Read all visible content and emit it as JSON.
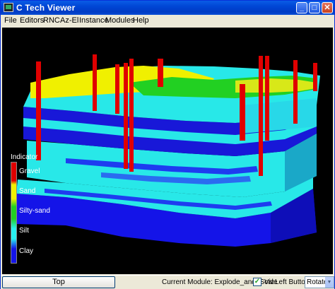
{
  "window": {
    "title": "C Tech Viewer"
  },
  "menu": {
    "items": [
      "File",
      "Editors",
      "RNC",
      "Az-El",
      "Instance",
      "Modules",
      "Help"
    ]
  },
  "legend": {
    "title": "Indicator",
    "labels": [
      "Gravel",
      "Sand",
      "Silty-sand",
      "Silt",
      "Clay"
    ]
  },
  "statusbar": {
    "top_button": "Top",
    "current_module": "Current Module: Explode_and_Scale",
    "viz_label": "Viz",
    "viz_checked": true,
    "left_button_label": "Left Button",
    "mode": "Rotate"
  },
  "colors": {
    "gravel": "#e00000",
    "sand": "#f0f000",
    "silty_sand": "#22d022",
    "silt": "#28f0f0",
    "clay": "#1414e8",
    "titlebar": "#0046d5"
  }
}
